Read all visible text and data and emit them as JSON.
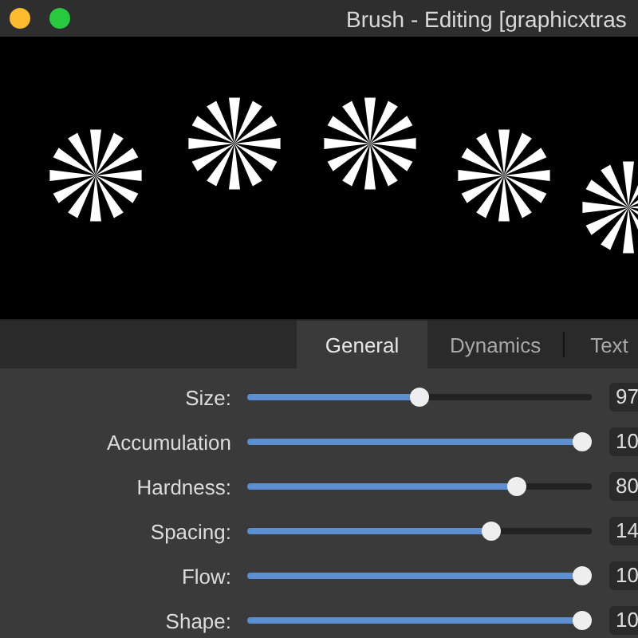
{
  "window": {
    "title": "Brush - Editing [graphicxtras"
  },
  "tabs": [
    {
      "label": "General",
      "selected": true
    },
    {
      "label": "Dynamics",
      "selected": false
    },
    {
      "label": "Text",
      "selected": false
    }
  ],
  "settings": [
    {
      "label": "Size:",
      "level": 0.5,
      "value": "97"
    },
    {
      "label": "Accumulation",
      "level": 1,
      "value": "10"
    },
    {
      "label": "Hardness:",
      "level": 0.8,
      "value": "80"
    },
    {
      "label": "Spacing:",
      "level": 0.72,
      "value": "14"
    },
    {
      "label": "Flow:",
      "level": 1,
      "value": "10"
    },
    {
      "label": "Shape:",
      "level": 1,
      "value": "10"
    }
  ]
}
